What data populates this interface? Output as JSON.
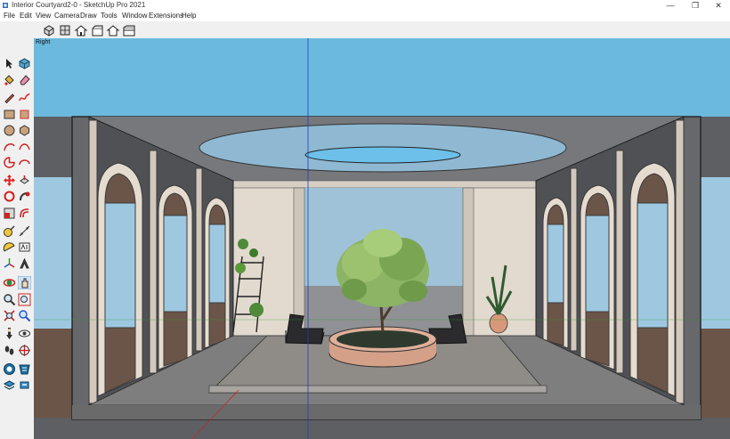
{
  "window": {
    "title": "Interior Courtyard2-0 - SketchUp Pro 2021",
    "minimize_glyph": "—",
    "maximize_glyph": "❐",
    "close_glyph": "✕"
  },
  "menu": {
    "items": [
      "File",
      "Edit",
      "View",
      "Camera",
      "Draw",
      "Tools",
      "Window",
      "Extensions",
      "Help"
    ]
  },
  "views_toolbar": {
    "icons": [
      "iso-view-icon",
      "top-view-icon",
      "front-view-icon",
      "right-view-icon",
      "back-view-icon",
      "left-view-icon"
    ]
  },
  "large_toolset": {
    "icons": [
      "select-arrow-icon",
      "component-icon",
      "paint-bucket-icon",
      "eraser-icon",
      "pencil-line-icon",
      "freehand-icon",
      "rectangle-icon",
      "rotated-rectangle-icon",
      "circle-icon",
      "polygon-icon",
      "arc-icon",
      "two-point-arc-icon",
      "pie-icon",
      "three-point-arc-icon",
      "move-icon",
      "push-pull-icon",
      "rotate-icon",
      "follow-me-icon",
      "scale-icon",
      "offset-icon",
      "tape-measure-icon",
      "dimension-icon",
      "protractor-icon",
      "text-icon",
      "axes-icon",
      "3d-text-icon",
      "orbit-icon",
      "pan-icon",
      "zoom-icon",
      "zoom-window-icon",
      "zoom-extents-icon",
      "zoom-previous-icon",
      "position-camera-icon",
      "look-around-icon",
      "walk-icon",
      "section-plane-icon",
      "warehouse-icon",
      "extension-warehouse-icon",
      "layout-icon",
      "extension-manager-icon"
    ]
  },
  "viewport": {
    "view_label": "Right",
    "sky_color": "#6cb9de",
    "wall_color": "#5d5f63",
    "floor_color": "#7e7e7e"
  }
}
